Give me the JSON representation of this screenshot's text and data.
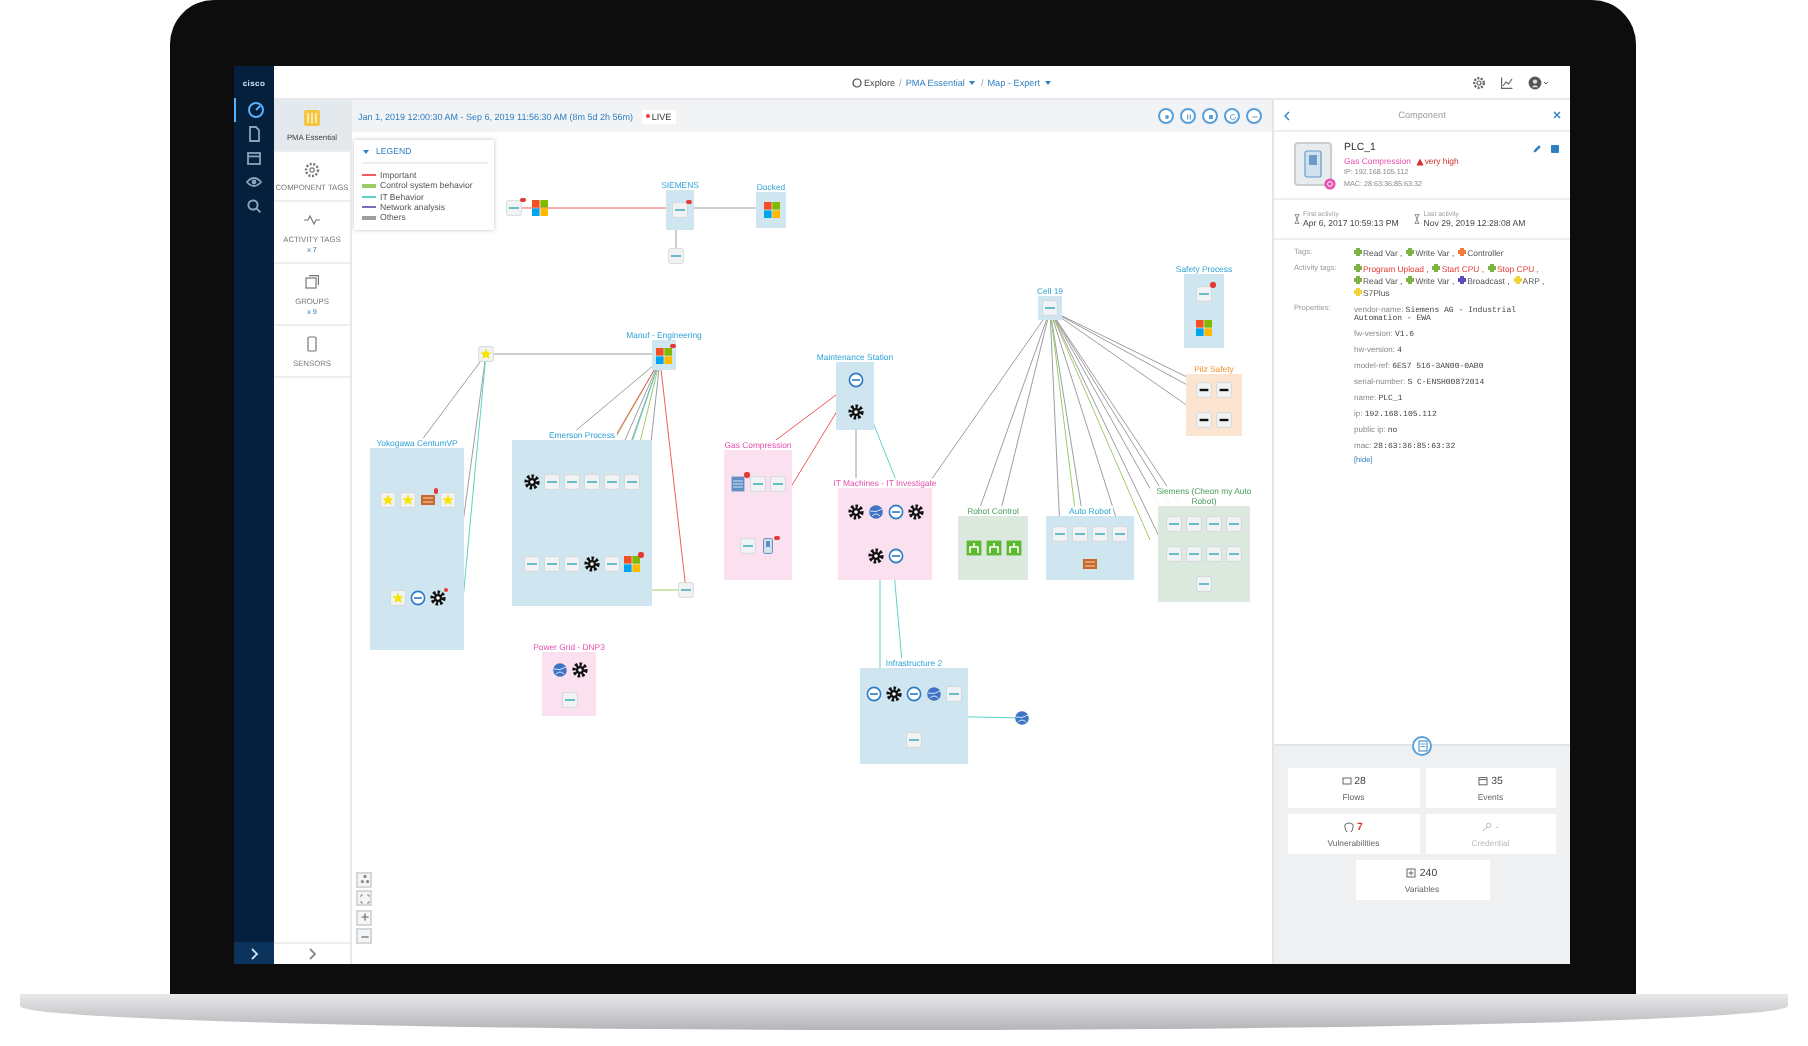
{
  "brand": "cisco",
  "nav": [
    {
      "kind": "gauge",
      "selected": true
    },
    {
      "kind": "document",
      "selected": false
    },
    {
      "kind": "calendar",
      "selected": false
    },
    {
      "kind": "eye",
      "selected": false
    },
    {
      "kind": "search",
      "selected": false
    }
  ],
  "breadcrumb": [
    {
      "label": "Explore",
      "dropdown": false
    },
    {
      "separator": "/",
      "label": "PMA Essential",
      "dropdown": true
    },
    {
      "separator": "/",
      "label": "Map - Expert",
      "dropdown": true
    }
  ],
  "sidebar": [
    {
      "kind": "preset",
      "label": "PMA Essential",
      "selected": true
    },
    {
      "kind": "tags",
      "label": "COMPONENT TAGS",
      "selected": false
    },
    {
      "kind": "activity",
      "label": "ACTIVITY TAGS",
      "count": "x 7",
      "selected": false
    },
    {
      "kind": "groups",
      "label": "GROUPS",
      "count": "x 9",
      "selected": false
    },
    {
      "kind": "sensors",
      "label": "SENSORS",
      "selected": false
    }
  ],
  "toolbar": {
    "time_range": "Jan 1, 2019 12:00:30 AM - Sep 6, 2019 11:56:30 AM",
    "duration": "(8m 5d 2h 56m)",
    "live": "LIVE"
  },
  "legend": {
    "title": "LEGEND",
    "expanded": true,
    "items": [
      {
        "label": "Important",
        "color": "#f25c5c"
      },
      {
        "label": "Control system behavior",
        "color": "#9ccc65"
      },
      {
        "label": "IT Behavior",
        "color": "#5fd1c8"
      },
      {
        "label": "Network analysis",
        "color": "#7e6bbf"
      },
      {
        "label": "Others",
        "color": "#9e9e9e"
      }
    ]
  },
  "map": {
    "groups": [
      {
        "label": "SIEMENS",
        "color": "#cfe6f0",
        "nodes": [
          {
            "kind": "device",
            "alert": true
          }
        ]
      },
      {
        "label": "Docked",
        "color": "#cfe6f0",
        "nodes": [
          {
            "kind": "windows",
            "alert": false
          }
        ]
      },
      {
        "label": "Safety Process",
        "color": "#cfe6f0",
        "nodes": [
          {
            "kind": "device",
            "alert": true
          },
          {
            "kind": "windows",
            "alert": false
          }
        ]
      },
      {
        "label": "Cell 19",
        "color": "#cfe6f0",
        "nodes": [
          {
            "kind": "device",
            "alert": false
          }
        ]
      },
      {
        "label": "Manuf - Engineering",
        "color": "#cfe6f0",
        "nodes": [
          {
            "kind": "windows",
            "alert": true
          }
        ]
      },
      {
        "label": "Maintenance Station",
        "color": "#cfe6f0",
        "nodes": [
          {
            "kind": "ring",
            "alert": false
          },
          {
            "kind": "gear",
            "alert": false
          }
        ]
      },
      {
        "label": "Pilz Safety",
        "color": "#fbe5d1",
        "nodes": [
          {
            "kind": "pilz",
            "alert": false
          },
          {
            "kind": "pilz",
            "alert": false
          },
          {
            "kind": "pilz",
            "alert": false
          },
          {
            "kind": "pilz",
            "alert": false
          }
        ]
      },
      {
        "label": "Yokogawa CentumVP",
        "color": "#cfe6f0",
        "nodes": [
          {
            "kind": "star",
            "alert": false
          },
          {
            "kind": "star",
            "alert": false
          },
          {
            "kind": "brick",
            "alert": true
          },
          {
            "kind": "star",
            "alert": false
          },
          {
            "kind": "star",
            "alert": false
          },
          {
            "kind": "ring",
            "alert": false
          },
          {
            "kind": "gear",
            "alert": true
          }
        ]
      },
      {
        "label": "Emerson Process",
        "color": "#cfe6f0",
        "nodes": [
          {
            "kind": "gear",
            "alert": false
          },
          {
            "kind": "device",
            "alert": false
          },
          {
            "kind": "device",
            "alert": false
          },
          {
            "kind": "device",
            "alert": false
          },
          {
            "kind": "device",
            "alert": false
          },
          {
            "kind": "device",
            "alert": false
          },
          {
            "kind": "device",
            "alert": false
          },
          {
            "kind": "device",
            "alert": false
          },
          {
            "kind": "device",
            "alert": false
          },
          {
            "kind": "gear",
            "alert": false
          },
          {
            "kind": "device",
            "alert": false
          },
          {
            "kind": "windows",
            "alert": true
          }
        ]
      },
      {
        "label": "Gas Compression",
        "color": "#fbe0ef",
        "nodes": [
          {
            "kind": "server",
            "alert": true
          },
          {
            "kind": "device",
            "alert": false
          },
          {
            "kind": "device",
            "alert": false
          },
          {
            "kind": "device",
            "alert": false
          },
          {
            "kind": "door",
            "alert": true
          }
        ]
      },
      {
        "label": "IT Machines - IT Investigate",
        "color": "#fbe0ef",
        "nodes": [
          {
            "kind": "gear",
            "alert": false
          },
          {
            "kind": "globe",
            "alert": false
          },
          {
            "kind": "ring",
            "alert": false
          },
          {
            "kind": "gear",
            "alert": false
          },
          {
            "kind": "gear",
            "alert": false
          },
          {
            "kind": "ring",
            "alert": false
          }
        ]
      },
      {
        "label": "Siemens (Cheon my Auto Robot)",
        "color": "#dce9df",
        "nodes": [
          {
            "kind": "device",
            "alert": false
          },
          {
            "kind": "device",
            "alert": false
          },
          {
            "kind": "device",
            "alert": false
          },
          {
            "kind": "device",
            "alert": false
          },
          {
            "kind": "device",
            "alert": false
          },
          {
            "kind": "device",
            "alert": false
          },
          {
            "kind": "device",
            "alert": false
          },
          {
            "kind": "device",
            "alert": false
          },
          {
            "kind": "device",
            "alert": false
          }
        ]
      },
      {
        "label": "Robot Control",
        "color": "#dce9df",
        "nodes": [
          {
            "kind": "robot",
            "alert": false
          },
          {
            "kind": "robot",
            "alert": false
          },
          {
            "kind": "robot",
            "alert": false
          }
        ]
      },
      {
        "label": "Auto Robot",
        "color": "#cfe6f0",
        "nodes": [
          {
            "kind": "device",
            "alert": false
          },
          {
            "kind": "device",
            "alert": false
          },
          {
            "kind": "device",
            "alert": false
          },
          {
            "kind": "device",
            "alert": false
          },
          {
            "kind": "brick",
            "alert": false
          }
        ]
      },
      {
        "label": "Power Grid - DNP3",
        "color": "#fbe0ef",
        "nodes": [
          {
            "kind": "globe",
            "alert": false
          },
          {
            "kind": "gear",
            "alert": false
          },
          {
            "kind": "device",
            "alert": false
          }
        ]
      },
      {
        "label": "Infrastructure 2",
        "color": "#cfe6f0",
        "nodes": [
          {
            "kind": "ring",
            "alert": false
          },
          {
            "kind": "gear",
            "alert": false
          },
          {
            "kind": "ring",
            "alert": false
          },
          {
            "kind": "globe",
            "alert": false
          },
          {
            "kind": "device",
            "alert": false
          },
          {
            "kind": "device",
            "alert": false
          }
        ]
      }
    ],
    "nodes": [
      {
        "kind": "device",
        "alert": true
      },
      {
        "kind": "windows",
        "alert": false
      },
      {
        "kind": "device",
        "alert": false
      },
      {
        "kind": "star",
        "alert": false
      },
      {
        "kind": "device",
        "alert": false
      },
      {
        "kind": "globe",
        "alert": false
      }
    ]
  },
  "component": {
    "header": "Component",
    "name": "PLC_1",
    "group": "Gas Compression",
    "risk": "very high",
    "ip": "IP: 192.168.105.112",
    "mac": "MAC: 28:63:36:85:63:32",
    "first_activity_label": "First activity",
    "first_activity": "Apr 6, 2017 10:59:13 PM",
    "last_activity_label": "Last activity",
    "last_activity": "Nov 29, 2019 12:28:08 AM",
    "tags_label": "Tags:",
    "tags": [
      {
        "label": "Read Var ,",
        "color": "#7cb342",
        "highlighted": false
      },
      {
        "label": "Write Var ,",
        "color": "#7cb342",
        "highlighted": false
      },
      {
        "label": "Controller",
        "color": "#f07c3c",
        "highlighted": false
      }
    ],
    "activity_tags_label": "Activity tags:",
    "activity_tags": [
      {
        "label": "Program Upload ,",
        "color": "#7cb342",
        "highlighted": true
      },
      {
        "label": "Start CPU ,",
        "color": "#7cb342",
        "highlighted": true
      },
      {
        "label": "Stop CPU ,",
        "color": "#7cb342",
        "highlighted": true
      },
      {
        "label": "Read Var ,",
        "color": "#7cb342",
        "highlighted": false
      },
      {
        "label": "Write Var ,",
        "color": "#7cb342",
        "highlighted": false
      },
      {
        "label": "Broadcast ,",
        "color": "#5b4bb5",
        "highlighted": false
      },
      {
        "label": "ARP ,",
        "color": "#f2d43a",
        "highlighted": false
      },
      {
        "label": "S7Plus",
        "color": "#f2d43a",
        "highlighted": false
      }
    ],
    "properties_label": "Properties:",
    "properties": [
      {
        "key": "vendor-name:",
        "value": "Siemens AG - Industrial Automation - EWA"
      },
      {
        "key": "fw-version:",
        "value": "V1.6"
      },
      {
        "key": "hw-version:",
        "value": "4"
      },
      {
        "key": "model-ref:",
        "value": "6ES7 516-3AN00-0AB0"
      },
      {
        "key": "serial-number:",
        "value": "S C-ENSH00872014"
      },
      {
        "key": "name:",
        "value": "PLC_1"
      },
      {
        "key": "ip:",
        "value": "192.168.105.112"
      },
      {
        "key": "public ip:",
        "value": "no"
      },
      {
        "key": "mac:",
        "value": "28:63:36:85:63:32"
      }
    ],
    "hide": "[hide]",
    "stats": [
      {
        "kind": "flows",
        "value": "28",
        "label": "Flows",
        "alert": false,
        "disabled": false
      },
      {
        "kind": "events",
        "value": "35",
        "label": "Events",
        "alert": false,
        "disabled": false
      },
      {
        "kind": "vulnerabilities",
        "value": "7",
        "label": "Vulnerabilities",
        "alert": true,
        "disabled": false
      },
      {
        "kind": "credential",
        "value": "-",
        "label": "Credential",
        "alert": false,
        "disabled": true
      },
      {
        "kind": "variables",
        "value": "240",
        "label": "Variables",
        "alert": false,
        "disabled": false
      }
    ]
  }
}
